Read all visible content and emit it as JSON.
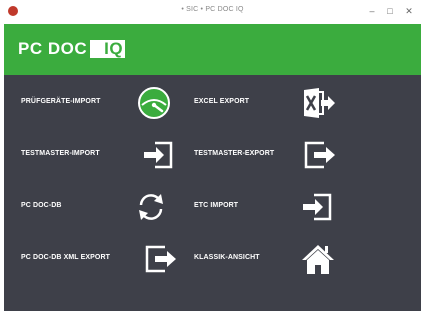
{
  "window": {
    "title": "• SIC • PC DOC IQ",
    "minimize_glyph": "–",
    "maximize_glyph": "□",
    "close_glyph": "✕"
  },
  "header": {
    "brand_prefix": "PC DOC",
    "brand_suffix": "IQ",
    "background_color": "#3bac3e"
  },
  "menu": {
    "left": [
      {
        "label": "PRÜFGERÄTE-IMPORT",
        "icon": "gauge-icon"
      },
      {
        "label": "TESTMASTER-IMPORT",
        "icon": "import-icon"
      },
      {
        "label": "PC DOC-DB",
        "icon": "sync-icon"
      },
      {
        "label": "PC DOC-DB XML EXPORT",
        "icon": "export-icon"
      }
    ],
    "right": [
      {
        "label": "EXCEL EXPORT",
        "icon": "excel-export-icon"
      },
      {
        "label": "TESTMASTER-EXPORT",
        "icon": "export-icon"
      },
      {
        "label": "ETC IMPORT",
        "icon": "import-icon"
      },
      {
        "label": "KLASSIK-ANSICHT",
        "icon": "home-icon"
      }
    ]
  },
  "colors": {
    "content_background": "#3e4049",
    "accent": "#3bac3e"
  }
}
